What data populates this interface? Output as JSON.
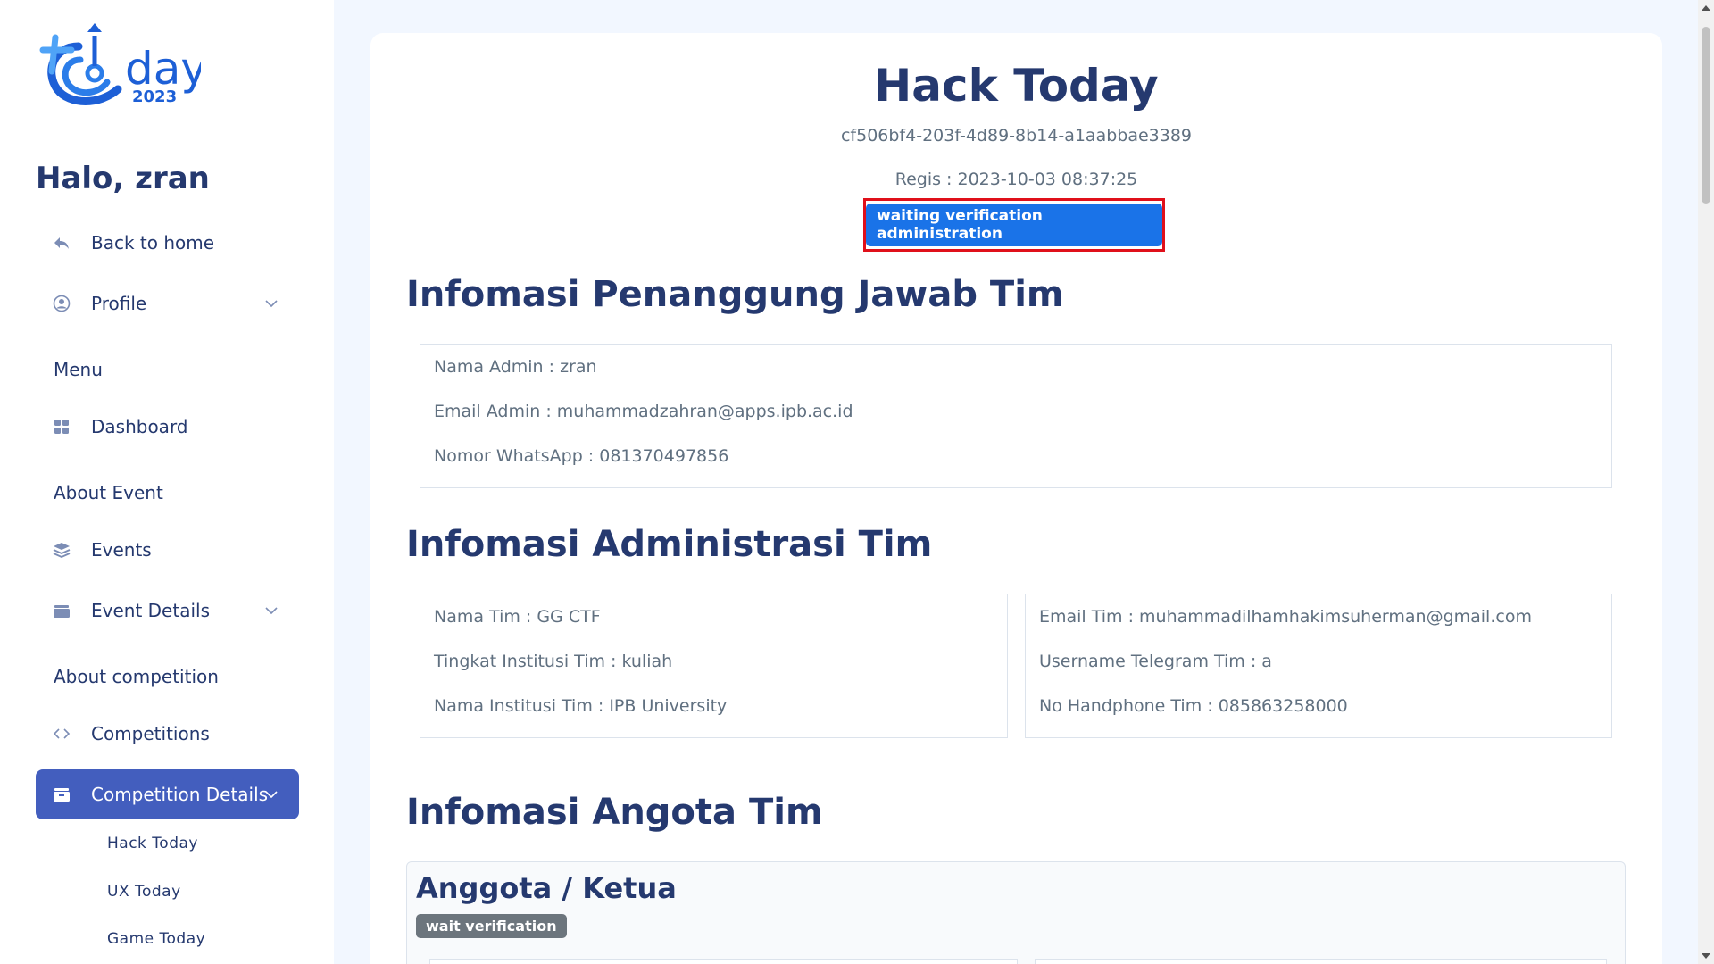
{
  "sidebar": {
    "logo_text": "day",
    "logo_year": "2023",
    "greeting": "Halo, zran",
    "back_home": "Back to home",
    "profile": "Profile",
    "menu_title": "Menu",
    "dashboard": "Dashboard",
    "about_event_title": "About Event",
    "events": "Events",
    "event_details": "Event Details",
    "about_competition_title": "About competition",
    "competitions": "Competitions",
    "competition_details": "Competition Details",
    "submenu": [
      "Hack Today",
      "UX Today",
      "Game Today"
    ]
  },
  "team": {
    "name": "Hack Today",
    "id": "cf506bf4-203f-4d89-8b14-a1aabbae3389",
    "regis": "Regis : 2023-10-03 08:37:25",
    "status": "waiting verification administration"
  },
  "sections": {
    "pj_heading": "Infomasi Penanggung Jawab Tim",
    "pj_lines": [
      "Nama Admin : zran",
      "Email Admin : muhammadzahran@apps.ipb.ac.id",
      "Nomor WhatsApp : 081370497856"
    ],
    "admin_heading": "Infomasi Administrasi Tim",
    "admin_left": [
      "Nama Tim : GG CTF",
      "Tingkat Institusi Tim : kuliah",
      "Nama Institusi Tim : IPB University"
    ],
    "admin_right": [
      "Email Tim : muhammadilhamhakimsuherman@gmail.com",
      "Username Telegram Tim : a",
      "No Handphone Tim : 085863258000"
    ],
    "member_heading": "Infomasi Angota Tim",
    "member_title": "Anggota / Ketua",
    "member_status": "wait verification"
  },
  "colors": {
    "primary": "#435ebe",
    "status_badge": "#1a73e8",
    "highlight_border": "#e0101a",
    "secondary_badge": "#6c757d",
    "text_dark": "#25396f"
  }
}
